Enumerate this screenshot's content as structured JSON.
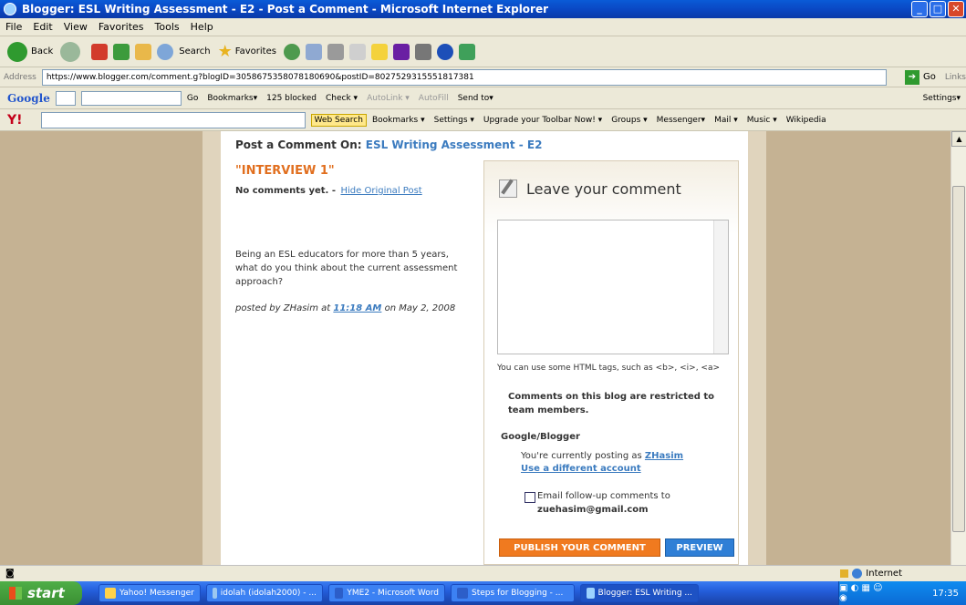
{
  "window": {
    "title": "Blogger: ESL Writing Assessment - E2 - Post a Comment - Microsoft Internet Explorer"
  },
  "menu": [
    "File",
    "Edit",
    "View",
    "Favorites",
    "Tools",
    "Help"
  ],
  "toolbar": {
    "back": "Back",
    "search": "Search",
    "favorites": "Favorites"
  },
  "address": {
    "label": "Address",
    "url": "https://www.blogger.com/comment.g?blogID=3058675358078180690&postID=8027529315551817381",
    "go": "Go",
    "links": "Links"
  },
  "google_bar": {
    "logo": "Google",
    "go": "Go",
    "items": [
      "Bookmarks▾",
      "125 blocked",
      "Check ▾",
      "AutoLink ▾",
      "AutoFill",
      "Send to▾"
    ],
    "settings": "Settings▾"
  },
  "yahoo_bar": {
    "logo": "Y!",
    "web_search": "Web Search",
    "items": [
      "Bookmarks ▾",
      "Settings ▾",
      "Upgrade your Toolbar Now! ▾",
      "Groups ▾",
      "Messenger▾",
      "Mail ▾",
      "Music ▾",
      "Wikipedia"
    ]
  },
  "post": {
    "heading_prefix": "Post a Comment On:",
    "blog_name": "ESL Writing Assessment - E2",
    "title": "\"INTERVIEW 1\"",
    "no_comments": "No comments yet. -",
    "hide_link": "Hide Original Post",
    "body": "Being an ESL educators for more than 5 years, what do you think about the current assessment approach?",
    "meta_prefix": "posted by ZHasim at",
    "time": "11:18 AM",
    "meta_suffix": "on May 2, 2008"
  },
  "comment_form": {
    "heading": "Leave your comment",
    "html_tip": "You can use some HTML tags, such as <b>, <i>, <a>",
    "restricted": "Comments on this blog are restricted to team members.",
    "identity_label": "Google/Blogger",
    "posting_as_prefix": "You're currently posting as",
    "username": "ZHasim",
    "different_account": "Use a different account",
    "follow_up": "Email follow-up comments to",
    "email": "zuehasim@gmail.com",
    "publish": "PUBLISH YOUR COMMENT",
    "preview": "PREVIEW"
  },
  "status": {
    "zone": "Internet"
  },
  "taskbar": {
    "start": "start",
    "tasks": [
      "Yahoo! Messenger",
      "idolah (idolah2000) - ...",
      "YME2 - Microsoft Word",
      "Steps for Blogging - ...",
      "Blogger: ESL Writing ..."
    ],
    "clock": "17:35"
  },
  "colors": {
    "accent": "#e16f1f",
    "link": "#3b7bbf",
    "publish": "#f07a1f",
    "preview": "#2f7fd6"
  }
}
